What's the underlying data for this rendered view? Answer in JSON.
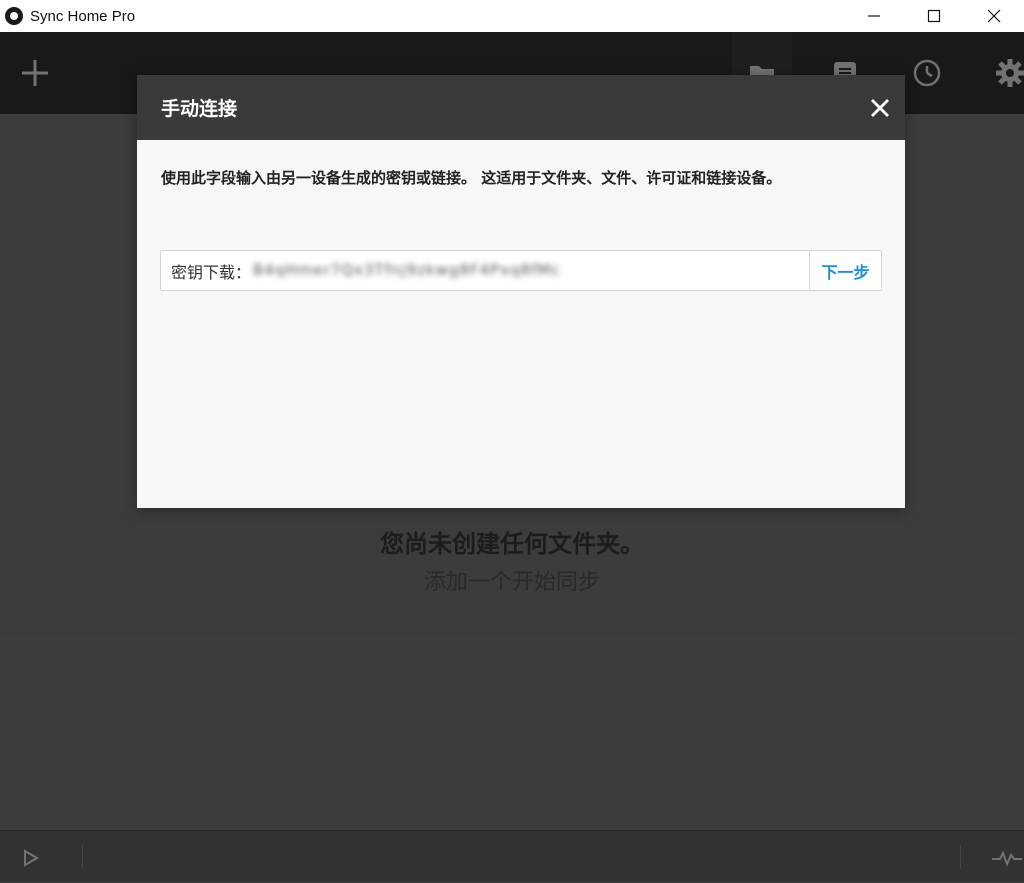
{
  "window": {
    "title": "Sync Home Pro",
    "icons": [
      "app-logo-icon",
      "minimize-icon",
      "maximize-icon",
      "close-icon"
    ]
  },
  "toolbar": {
    "icons": [
      "plus-icon",
      "folder-icon",
      "list-icon",
      "clock-icon",
      "gear-icon"
    ]
  },
  "main": {
    "empty_title": "您尚未创建任何文件夹。",
    "empty_subtitle": "添加一个开始同步"
  },
  "statusbar": {
    "icons": [
      "play-icon",
      "activity-icon"
    ]
  },
  "modal": {
    "title": "手动连接",
    "description": "使用此字段输入由另一设备生成的密钥或链接。 这适用于文件夹、文件、许可证和链接设备。",
    "key_label": "密钥下载：",
    "key_value": "B4qHmer7Qx3Tfnj9zkwg8F4Pxq8fMc",
    "next_label": "下一步"
  },
  "colors": {
    "accent": "#1a8fd6",
    "modal_header": "#3a3a3a",
    "toolbar": "#1f1f1f"
  }
}
